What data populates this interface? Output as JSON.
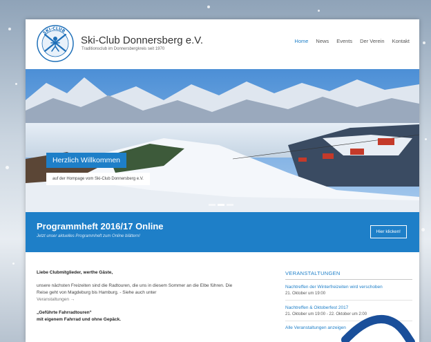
{
  "site": {
    "title": "Ski-Club Donnersberg e.V.",
    "subtitle": "Traditionsclub im Donnersbergkreis seit 1970",
    "logo_text": "SKI-CLUB"
  },
  "nav": {
    "items": [
      {
        "label": "Home",
        "active": true
      },
      {
        "label": "News",
        "active": false
      },
      {
        "label": "Events",
        "active": false
      },
      {
        "label": "Der Verein",
        "active": false
      },
      {
        "label": "Kontakt",
        "active": false
      }
    ]
  },
  "hero": {
    "title": "Herzlich Willkommen",
    "subtitle": "auf der Hompage vom Ski-Club Donnersberg e.V."
  },
  "banner": {
    "title": "Programmheft 2016/17 Online",
    "subtitle": "Jetzt unser aktuelles Programmheft zum Online blättern!",
    "button": "Hier klicken!"
  },
  "content": {
    "greeting": "Liebe Clubmitglieder, werthe Gäste,",
    "paragraph": "unsere nächsten Freizeiten sind die Radtouren, die uns in diesem Sommer an die Elbe führen. Die Reise geht von Magdeburg bis Hamburg. - Siehe auch unter",
    "paragraph_link": "Veranstaltungen →",
    "bold_line1": "„Geführte Fahrradtouren“",
    "bold_line2": "mit eigenem Fahrrad und ohne Gepäck."
  },
  "sidebar": {
    "heading": "VERANSTALTUNGEN",
    "events": [
      {
        "title": "Nachtreffen der Winterfreizeiten wird verschoben",
        "date": "21. Oktober um 19:00"
      },
      {
        "title": "Nachtreffen & Oktoberfest 2017",
        "date": "21. Oktober um 19:00 - 22. Oktober um 2:00"
      }
    ],
    "more": "Alle Veranstaltungen anzeigen"
  },
  "colors": {
    "accent": "#1e7fc8"
  }
}
